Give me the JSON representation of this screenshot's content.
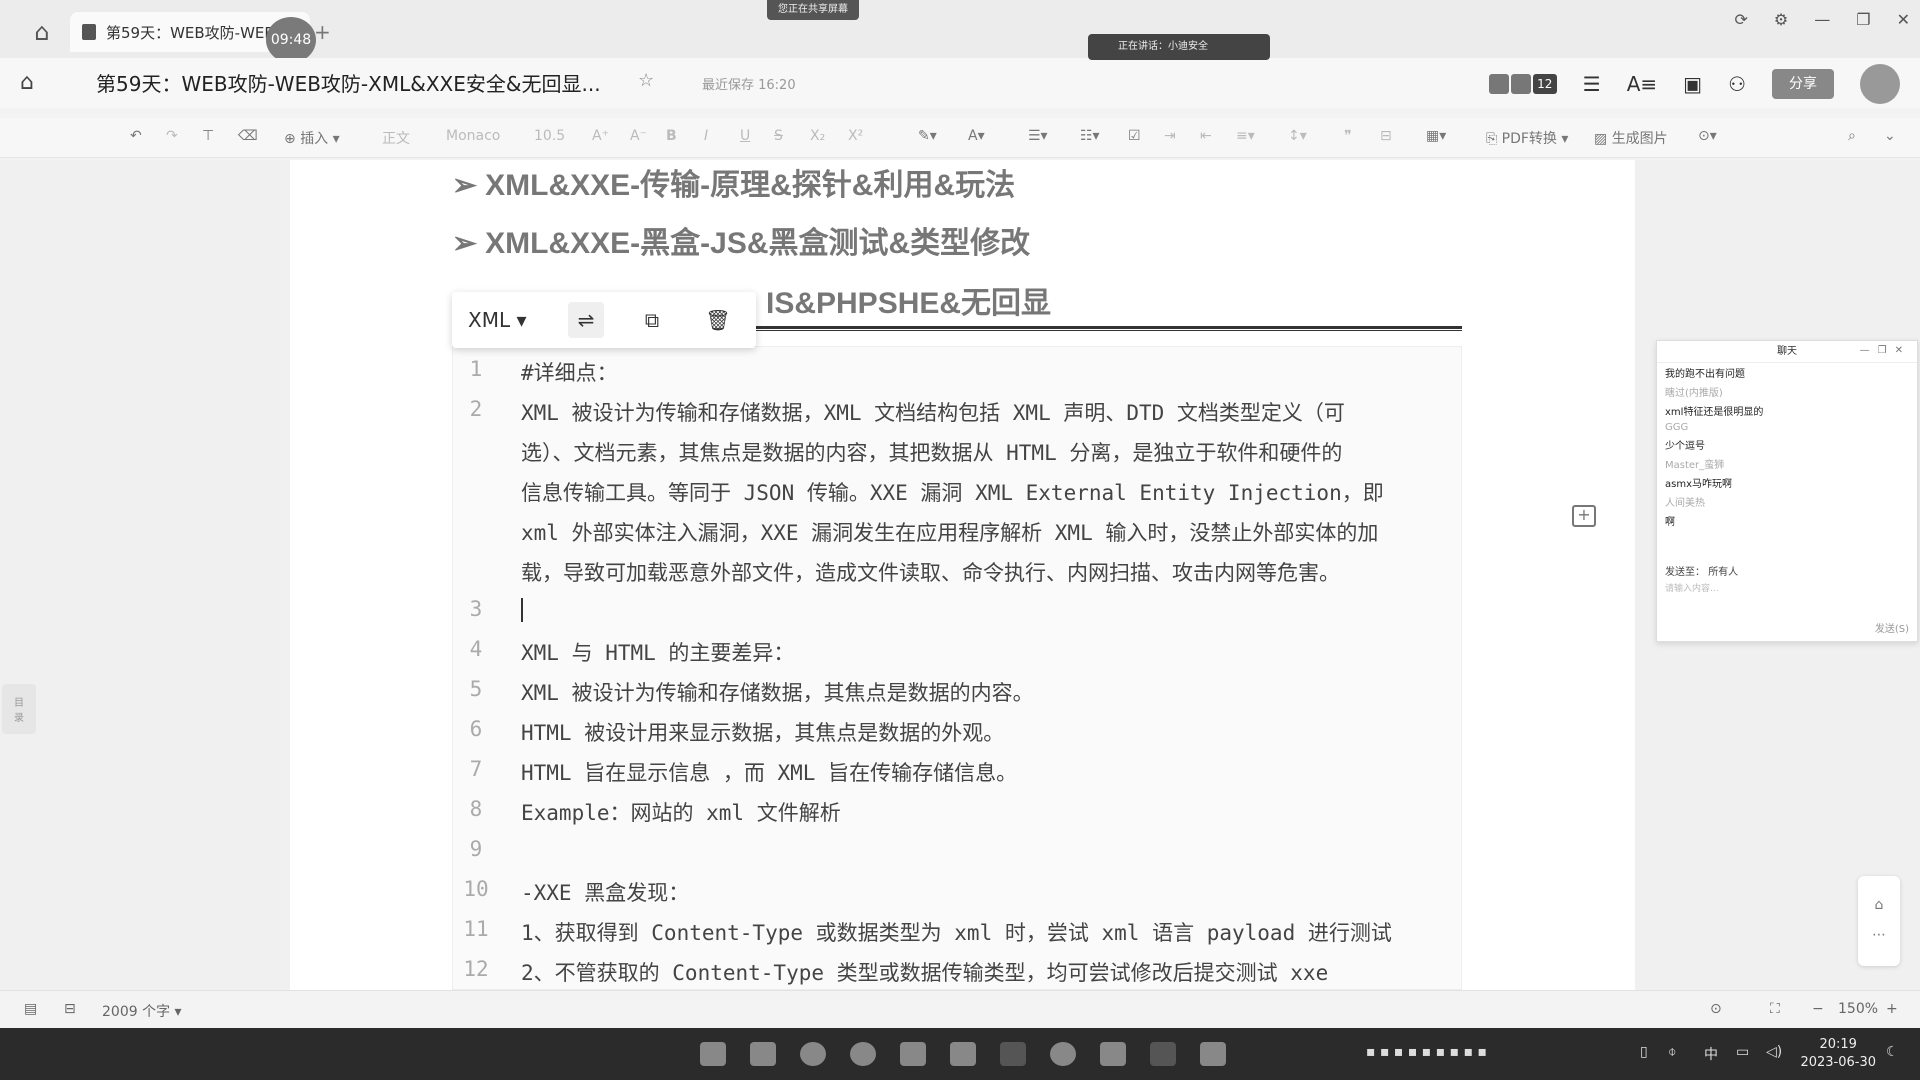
{
  "tabbar": {
    "tab_title": "第59天：WEB攻防-WEB...",
    "timer": "09:48",
    "add": "+",
    "screenshare_label": "您正在共享屏幕",
    "window_controls": [
      "⟳",
      "⚙",
      "—",
      "❐",
      "✕"
    ]
  },
  "header": {
    "home_icon": "⌂",
    "title": "第59天：WEB攻防-WEB攻防-XML&XXE安全&无回显...",
    "star_icon": "☆",
    "saved": "最近保存 16:20",
    "talk": "正在讲话：小迪安全",
    "collaborator_count": "12",
    "share": "分享"
  },
  "toolbar": {
    "insert": "插入",
    "style": "正文",
    "font": "Monaco",
    "size": "10.5",
    "pdf": "PDF转换",
    "image": "生成图片"
  },
  "doc": {
    "headings": [
      "XML&XXE-传输-原理&探针&利用&玩法",
      "XML&XXE-黑盒-JS&黑盒测试&类型修改",
      "IS&PHPSHE&无回显"
    ],
    "bullet": "➢",
    "code_toolbar": {
      "language": "XML"
    },
    "code_lines": [
      {
        "n": "1",
        "text": "#详细点："
      },
      {
        "n": "2",
        "text": "XML 被设计为传输和存储数据，XML 文档结构包括 XML 声明、DTD 文档类型定义（可"
      },
      {
        "n": "",
        "text": "选）、文档元素，其焦点是数据的内容，其把数据从 HTML 分离，是独立于软件和硬件的"
      },
      {
        "n": "",
        "text": "信息传输工具。等同于 JSON 传输。XXE 漏洞 XML External Entity Injection，即"
      },
      {
        "n": "",
        "text": "xml 外部实体注入漏洞，XXE 漏洞发生在应用程序解析 XML 输入时，没禁止外部实体的加"
      },
      {
        "n": "",
        "text": "载，导致可加载恶意外部文件，造成文件读取、命令执行、内网扫描、攻击内网等危害。"
      },
      {
        "n": "3",
        "text": ""
      },
      {
        "n": "4",
        "text": "XML 与 HTML 的主要差异："
      },
      {
        "n": "5",
        "text": "XML 被设计为传输和存储数据，其焦点是数据的内容。"
      },
      {
        "n": "6",
        "text": "HTML 被设计用来显示数据，其焦点是数据的外观。"
      },
      {
        "n": "7",
        "text": "HTML 旨在显示信息 ，而 XML 旨在传输存储信息。"
      },
      {
        "n": "8",
        "text": "Example：网站的 xml 文件解析"
      },
      {
        "n": "9",
        "text": ""
      },
      {
        "n": "10",
        "text": "-XXE 黑盒发现："
      },
      {
        "n": "11",
        "text": "1、获取得到 Content-Type 或数据类型为 xml 时，尝试 xml 语言 payload 进行测试"
      },
      {
        "n": "12",
        "text": "2、不管获取的 Content-Type 类型或数据传输类型，均可尝试修改后提交测试 xxe"
      }
    ]
  },
  "chat": {
    "title": "聊天",
    "messages": [
      {
        "text": "我的跑不出有问题",
        "meta": false
      },
      {
        "text": "瞎过(内推版)",
        "meta": true
      },
      {
        "text": "xml特征还是很明显的",
        "meta": false
      },
      {
        "text": "GGG",
        "meta": true
      },
      {
        "text": "少个逗号",
        "meta": false
      },
      {
        "text": "Master_蛮狮",
        "meta": true
      },
      {
        "text": "asmx马咋玩啊",
        "meta": false
      },
      {
        "text": "人间美热",
        "meta": true
      },
      {
        "text": "啊",
        "meta": false
      }
    ],
    "send_to_label": "发送至：",
    "send_to_value": "所有人",
    "placeholder": "请输入内容...",
    "send": "发送(S)"
  },
  "statusbar": {
    "word_count": "2009 个字",
    "zoom": "150%"
  },
  "taskbar": {
    "time": "20:19",
    "date": "2023-06-30",
    "ime": "中"
  }
}
